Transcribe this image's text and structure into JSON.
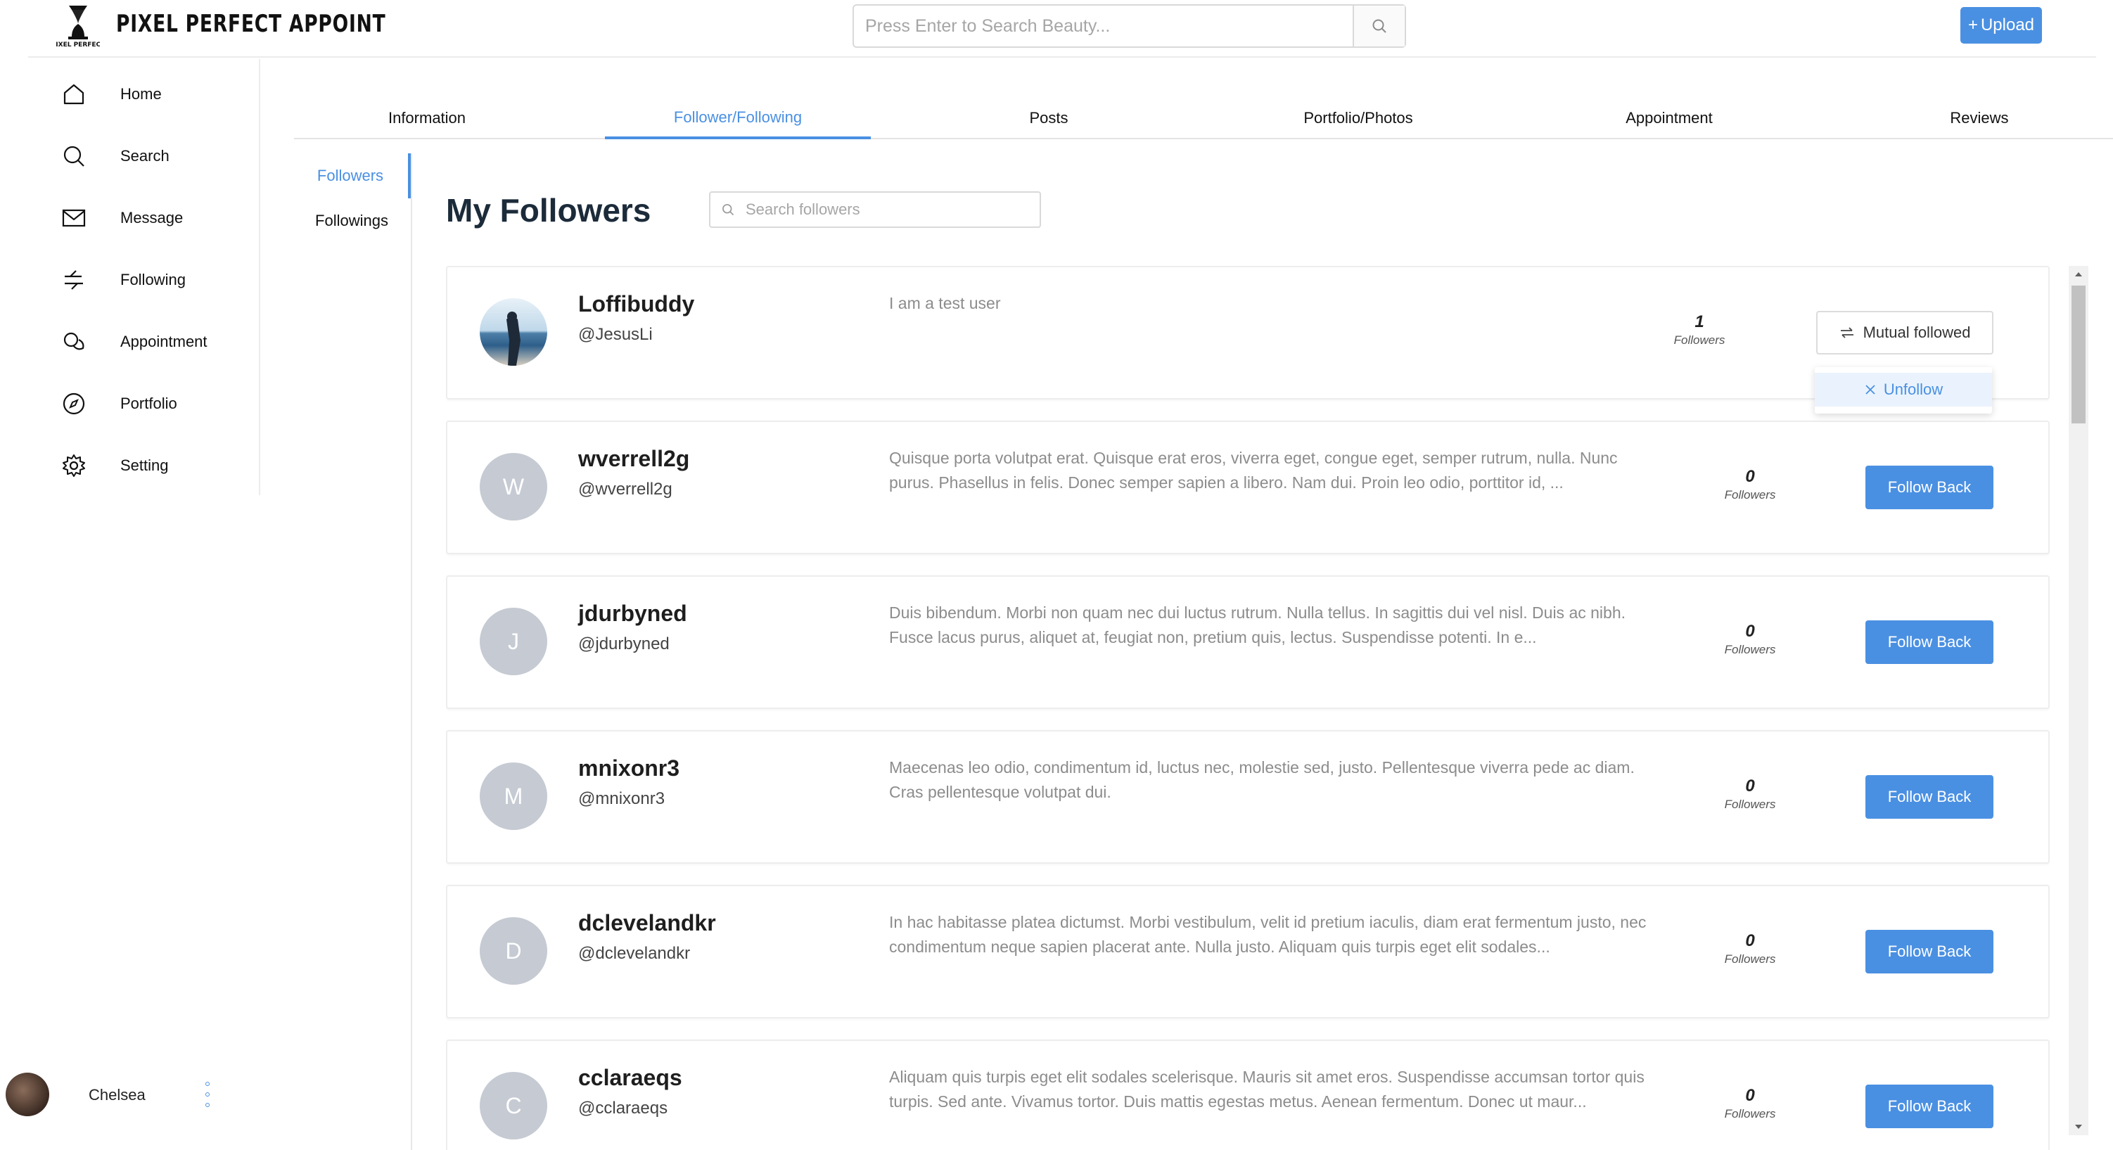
{
  "app": {
    "logo_text": "PIXEL PERFECT APPOINT",
    "logo_small_text": "PIXEL PERFECT"
  },
  "header": {
    "search_placeholder": "Press Enter to Search Beauty...",
    "upload_label": "Upload",
    "accent_color": "#4a90e2"
  },
  "sidebar": {
    "items": [
      {
        "label": "Home",
        "icon": "home-icon"
      },
      {
        "label": "Search",
        "icon": "search-icon"
      },
      {
        "label": "Message",
        "icon": "mail-icon"
      },
      {
        "label": "Following",
        "icon": "arrows-icon"
      },
      {
        "label": "Appointment",
        "icon": "chat-bubbles-icon"
      },
      {
        "label": "Portfolio",
        "icon": "compass-icon"
      },
      {
        "label": "Setting",
        "icon": "gear-icon"
      }
    ],
    "user_name": "Chelsea"
  },
  "tabs": [
    {
      "label": "Information",
      "active": false
    },
    {
      "label": "Follower/Following",
      "active": true
    },
    {
      "label": "Posts",
      "active": false
    },
    {
      "label": "Portfolio/Photos",
      "active": false
    },
    {
      "label": "Appointment",
      "active": false
    },
    {
      "label": "Reviews",
      "active": false
    }
  ],
  "subnav": [
    {
      "label": "Followers",
      "active": true
    },
    {
      "label": "Followings",
      "active": false
    }
  ],
  "main": {
    "title": "My Followers",
    "search_placeholder": "Search followers"
  },
  "followers_label": "Followers",
  "followers": [
    {
      "name": "Loffibuddy",
      "handle": "@JesusLi",
      "bio": "I am a test user",
      "count": "1",
      "initial": "",
      "action": "Mutual followed"
    },
    {
      "name": "wverrell2g",
      "handle": "@wverrell2g",
      "bio": "Quisque porta volutpat erat. Quisque erat eros, viverra eget, congue eget, semper rutrum, nulla. Nunc purus. Phasellus in felis. Donec semper sapien a libero. Nam dui. Proin leo odio, porttitor id, ...",
      "count": "0",
      "initial": "W",
      "action": "Follow Back"
    },
    {
      "name": "jdurbyned",
      "handle": "@jdurbyned",
      "bio": "Duis bibendum. Morbi non quam nec dui luctus rutrum. Nulla tellus. In sagittis dui vel nisl. Duis ac nibh. Fusce lacus purus, aliquet at, feugiat non, pretium quis, lectus. Suspendisse potenti. In e...",
      "count": "0",
      "initial": "J",
      "action": "Follow Back"
    },
    {
      "name": "mnixonr3",
      "handle": "@mnixonr3",
      "bio": "Maecenas leo odio, condimentum id, luctus nec, molestie sed, justo. Pellentesque viverra pede ac diam. Cras pellentesque volutpat dui.",
      "count": "0",
      "initial": "M",
      "action": "Follow Back"
    },
    {
      "name": "dclevelandkr",
      "handle": "@dclevelandkr",
      "bio": "In hac habitasse platea dictumst. Morbi vestibulum, velit id pretium iaculis, diam erat fermentum justo, nec condimentum neque sapien placerat ante. Nulla justo. Aliquam quis turpis eget elit sodales...",
      "count": "0",
      "initial": "D",
      "action": "Follow Back"
    },
    {
      "name": "cclaraeqs",
      "handle": "@cclaraeqs",
      "bio": "Aliquam quis turpis eget elit sodales scelerisque. Mauris sit amet eros. Suspendisse accumsan tortor quis turpis. Sed ante. Vivamus tortor. Duis mattis egestas metus. Aenean fermentum. Donec ut maur...",
      "count": "0",
      "initial": "C",
      "action": "Follow Back"
    }
  ],
  "dropdown": {
    "unfollow_label": "Unfollow"
  }
}
